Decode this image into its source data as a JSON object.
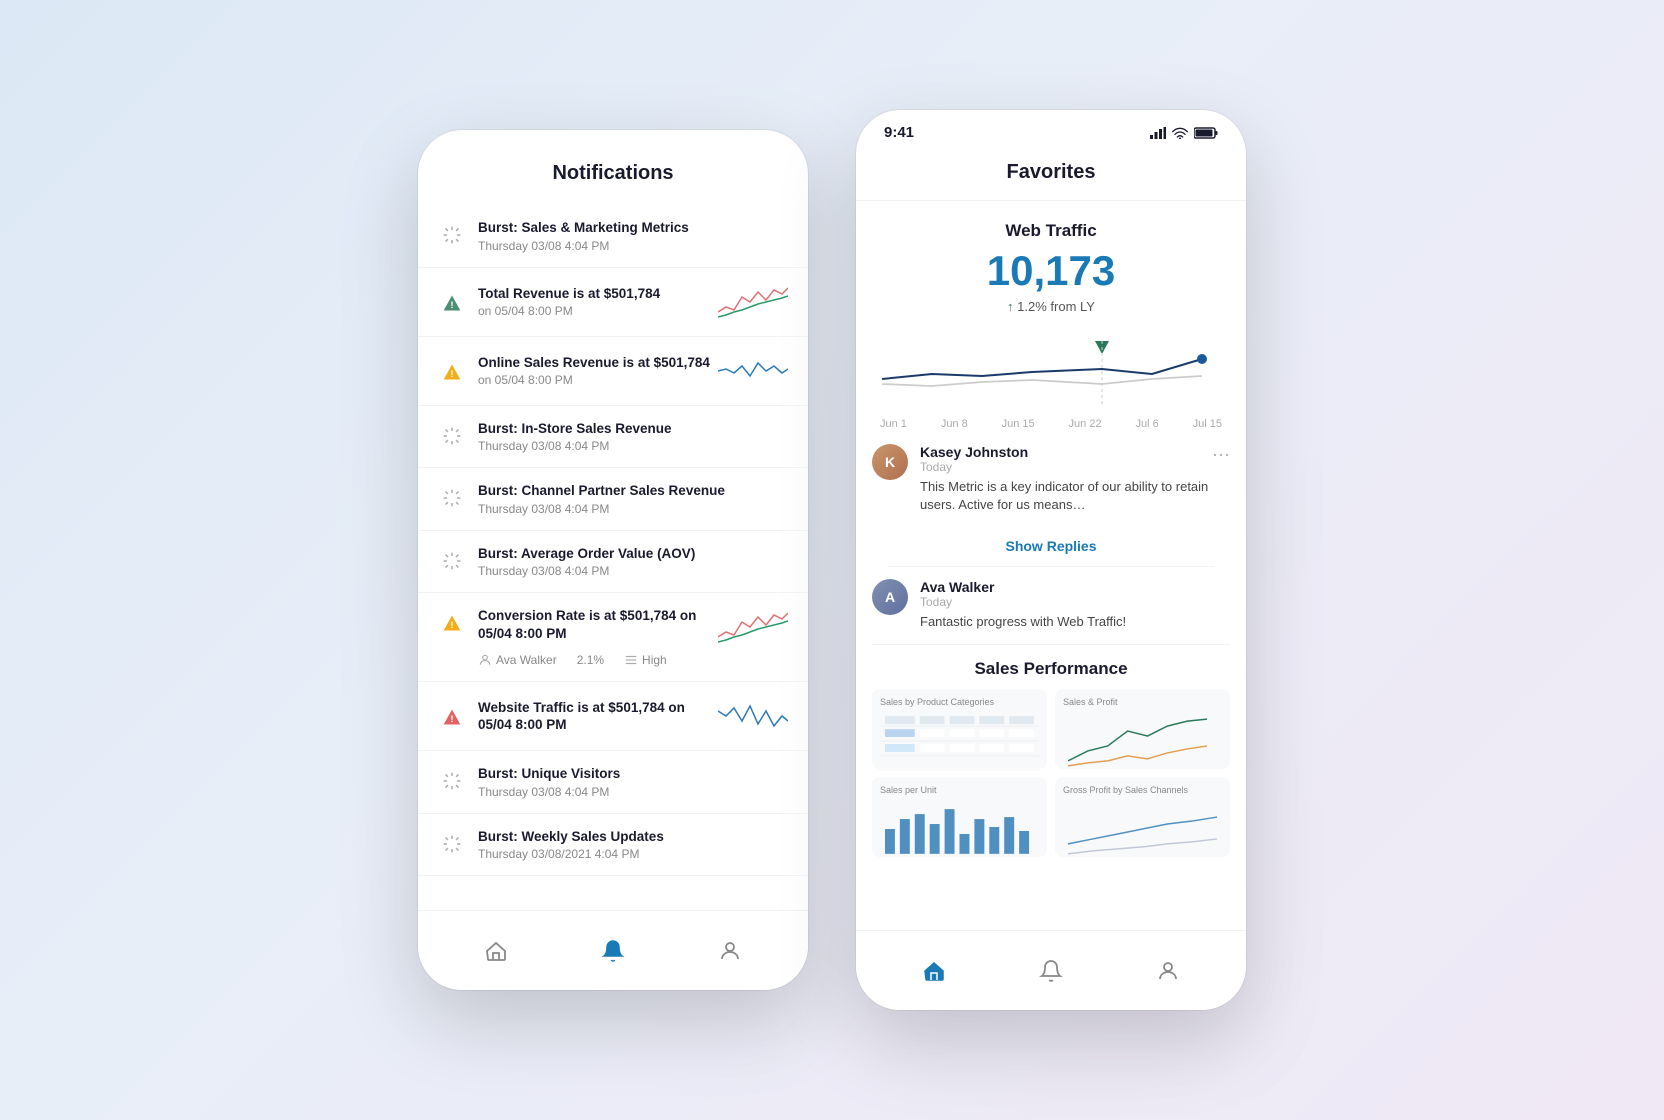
{
  "phone1": {
    "title": "Notifications",
    "notifications": [
      {
        "id": "notif-1",
        "icon": "burst",
        "title": "Burst: Sales & Marketing Metrics",
        "subtitle": "Thursday 03/08 4:04 PM",
        "hasChart": false,
        "alertType": "burst"
      },
      {
        "id": "notif-2",
        "icon": "alert-green",
        "title": "Total Revenue is at $501,784",
        "subtitle": "on 05/04 8:00 PM",
        "hasChart": true,
        "alertType": "green"
      },
      {
        "id": "notif-3",
        "icon": "alert-yellow",
        "title": "Online Sales Revenue is at $501,784",
        "subtitle": "on 05/04 8:00 PM",
        "hasChart": true,
        "alertType": "yellow"
      },
      {
        "id": "notif-4",
        "icon": "burst",
        "title": "Burst: In-Store Sales Revenue",
        "subtitle": "Thursday 03/08 4:04 PM",
        "hasChart": false,
        "alertType": "burst"
      },
      {
        "id": "notif-5",
        "icon": "burst",
        "title": "Burst: Channel Partner Sales Revenue",
        "subtitle": "Thursday 03/08 4:04 PM",
        "hasChart": false,
        "alertType": "burst"
      },
      {
        "id": "notif-6",
        "icon": "burst",
        "title": "Burst: Average Order Value (AOV)",
        "subtitle": "Thursday 03/08 4:04 PM",
        "hasChart": false,
        "alertType": "burst"
      },
      {
        "id": "notif-7",
        "icon": "alert-yellow",
        "title": "Conversion Rate is at $501,784 on 05/04 8:00 PM",
        "subtitle": "",
        "hasChart": true,
        "alertType": "yellow",
        "hasMeta": true,
        "metaUser": "Ava Walker",
        "metaValue": "2.1%",
        "metaPriority": "High"
      },
      {
        "id": "notif-8",
        "icon": "alert-red",
        "title": "Website Traffic is at $501,784 on 05/04 8:00 PM",
        "subtitle": "",
        "hasChart": true,
        "alertType": "red"
      },
      {
        "id": "notif-9",
        "icon": "burst",
        "title": "Burst: Unique Visitors",
        "subtitle": "Thursday 03/08 4:04 PM",
        "hasChart": false,
        "alertType": "burst"
      },
      {
        "id": "notif-10",
        "icon": "burst",
        "title": "Burst: Weekly Sales Updates",
        "subtitle": "Thursday 03/08/2021 4:04 PM",
        "hasChart": false,
        "alertType": "burst"
      }
    ],
    "nav": {
      "home": "Home",
      "bell": "Notifications",
      "profile": "Profile"
    }
  },
  "phone2": {
    "statusBar": {
      "time": "9:41"
    },
    "title": "Favorites",
    "metric": {
      "name": "Web Traffic",
      "value": "10,173",
      "changeArrow": "↑",
      "changeValue": "1.2%",
      "changeLabel": "from LY"
    },
    "chart": {
      "labels": [
        "Jun 1",
        "Jun 8",
        "Jun 15",
        "Jun 22",
        "Jul 6",
        "Jul 15"
      ]
    },
    "comments": [
      {
        "id": "comment-1",
        "author": "Kasey Johnston",
        "avatarColor": "#b08050",
        "avatarInitial": "K",
        "time": "Today",
        "text": "This Metric is a key indicator of our ability to retain users. Active for us means…"
      },
      {
        "id": "comment-2",
        "author": "Ava Walker",
        "avatarColor": "#7a8aaa",
        "avatarInitial": "A",
        "time": "Today",
        "text": "Fantastic progress with Web Traffic!"
      }
    ],
    "showRepliesLabel": "Show Replies",
    "salesSection": {
      "title": "Sales Performance",
      "charts": [
        {
          "label": "Sales by Product Categories",
          "type": "table"
        },
        {
          "label": "Sales & Profit",
          "type": "line"
        },
        {
          "label": "Sales per Unit",
          "type": "bar"
        },
        {
          "label": "Gross Profit by Sales Channels",
          "type": "line"
        }
      ]
    },
    "nav": {
      "home": "Home",
      "bell": "Notifications",
      "profile": "Profile"
    }
  }
}
